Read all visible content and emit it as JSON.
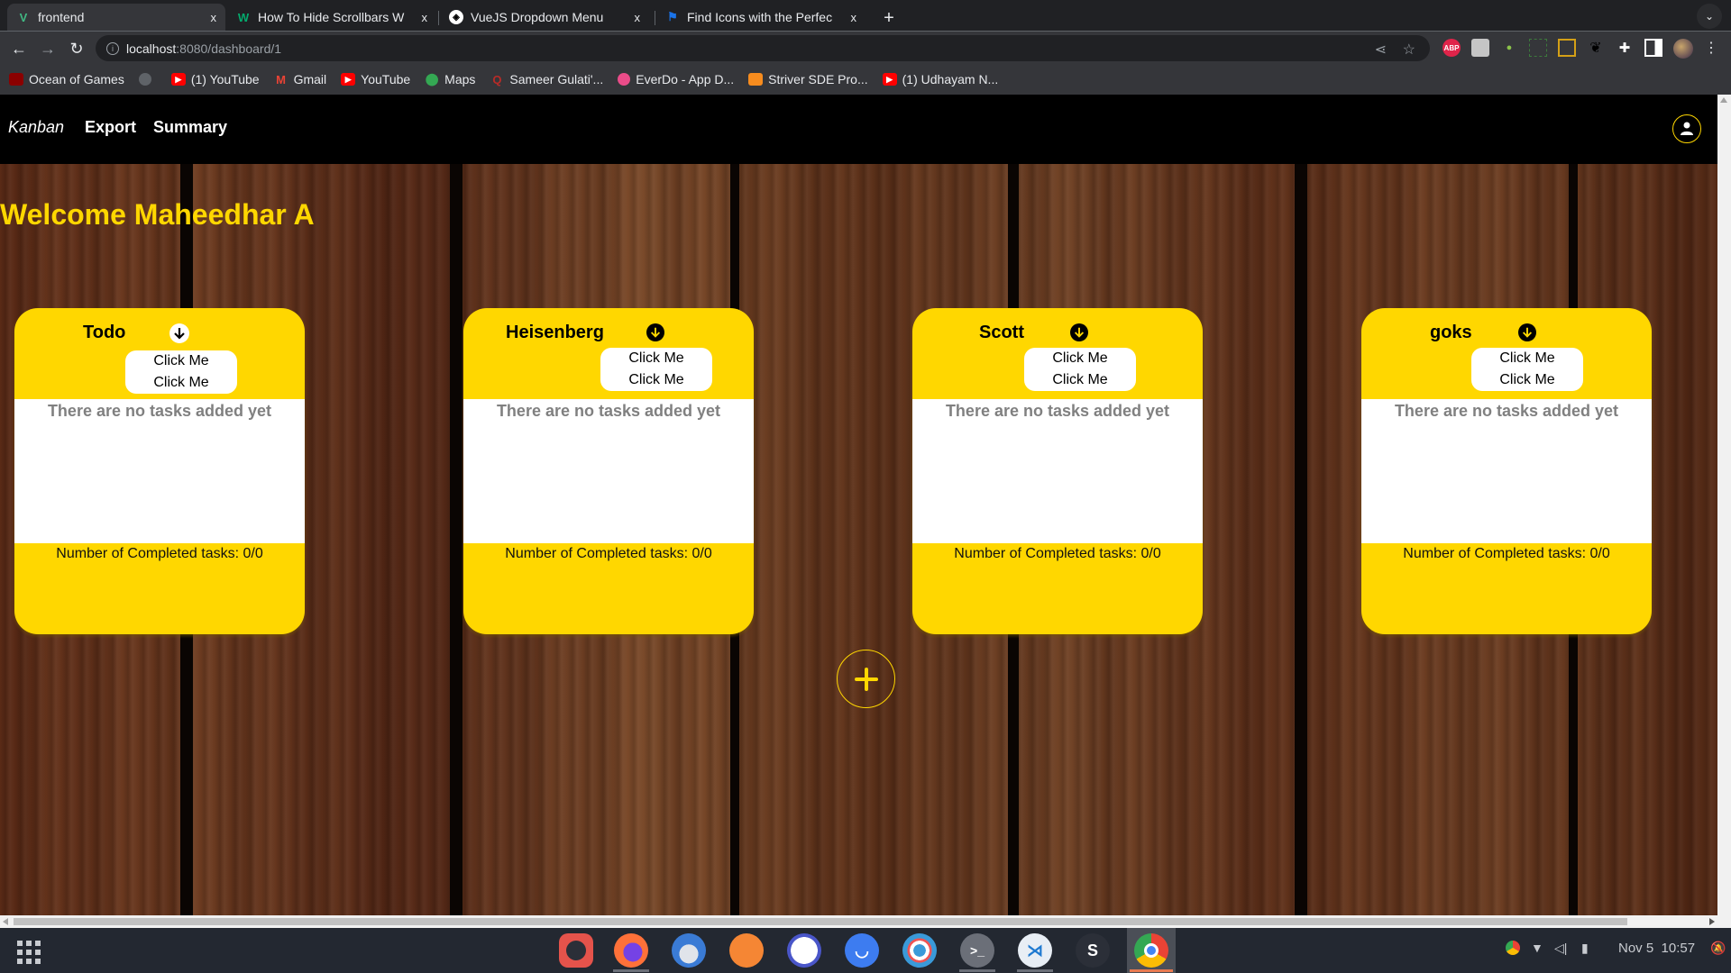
{
  "browser": {
    "tabs": [
      {
        "title": "frontend",
        "favicon": "vue-icon",
        "active": true
      },
      {
        "title": "How To Hide Scrollbars W",
        "favicon": "w3schools-icon",
        "active": false
      },
      {
        "title": "VueJS Dropdown Menu",
        "favicon": "codepen-icon",
        "active": false
      },
      {
        "title": "Find Icons with the Perfec",
        "favicon": "flag-icon",
        "active": false
      }
    ],
    "close_glyph": "x",
    "new_tab_glyph": "+",
    "url_host": "localhost",
    "url_path": ":8080/dashboard/1",
    "bookmarks": [
      {
        "label": "Ocean of Games",
        "icon": "gamepad-icon",
        "color": "#8b0000"
      },
      {
        "label": "",
        "icon": "globe-icon",
        "color": "#5f6368"
      },
      {
        "label": "(1) YouTube",
        "icon": "youtube-icon",
        "color": "#ff0000"
      },
      {
        "label": "Gmail",
        "icon": "gmail-icon",
        "color": "#ea4335"
      },
      {
        "label": "YouTube",
        "icon": "youtube-icon",
        "color": "#ff0000"
      },
      {
        "label": "Maps",
        "icon": "maps-icon",
        "color": "#34a853"
      },
      {
        "label": "Sameer Gulati'...",
        "icon": "quora-icon",
        "color": "#b92b27"
      },
      {
        "label": "EverDo - App D...",
        "icon": "dribbble-icon",
        "color": "#ea4c89"
      },
      {
        "label": "Striver SDE Pro...",
        "icon": "codingninjas-icon",
        "color": "#f78c1e"
      },
      {
        "label": "(1) Udhayam N...",
        "icon": "youtube-icon",
        "color": "#ff0000"
      }
    ],
    "extensions": [
      "abp-icon",
      "contact-icon",
      "download-x-icon",
      "screen-capture-icon",
      "window-resizer-icon",
      "gnome-icon",
      "puzzle-extensions-icon",
      "side-panel-icon",
      "profile-avatar-icon",
      "kebab-menu-icon"
    ],
    "abp_label": "ABP"
  },
  "app": {
    "nav": {
      "brand": "Kanban",
      "export": "Export",
      "summary": "Summary"
    },
    "welcome": "Welcome Maheedhar A",
    "colors": {
      "accent": "#ffd700",
      "header_bg": "#000000",
      "empty_text": "#808080"
    },
    "boards": [
      {
        "title": "Todo",
        "menu_items": [
          "Click Me",
          "Click Me"
        ],
        "empty_text": "There are no tasks added yet",
        "completed_label": "Number of Completed tasks:",
        "completed": 0,
        "total": 0,
        "completed_text": "Number of Completed tasks: 0/0",
        "icon_style": "light"
      },
      {
        "title": "Heisenberg",
        "menu_items": [
          "Click Me",
          "Click Me"
        ],
        "empty_text": "There are no tasks added yet",
        "completed_label": "Number of Completed tasks:",
        "completed": 0,
        "total": 0,
        "completed_text": "Number of Completed tasks: 0/0",
        "icon_style": "dark"
      },
      {
        "title": "Scott",
        "menu_items": [
          "Click Me",
          "Click Me"
        ],
        "empty_text": "There are no tasks added yet",
        "completed_label": "Number of Completed tasks:",
        "completed": 0,
        "total": 0,
        "completed_text": "Number of Completed tasks: 0/0",
        "icon_style": "dark"
      },
      {
        "title": "goks",
        "menu_items": [
          "Click Me",
          "Click Me"
        ],
        "empty_text": "There are no tasks added yet",
        "completed_label": "Number of Completed tasks:",
        "completed": 0,
        "total": 0,
        "completed_text": "Number of Completed tasks: 0/0",
        "icon_style": "dark"
      }
    ],
    "add_board_glyph": "+"
  },
  "taskbar": {
    "apps": [
      {
        "name": "screen-recorder-icon",
        "color": "#e5534b",
        "glyph": ""
      },
      {
        "name": "firefox-icon",
        "color": "#ff7139",
        "glyph": ""
      },
      {
        "name": "thunderbird-icon",
        "color": "#3a7bd5",
        "glyph": ""
      },
      {
        "name": "files-icon",
        "color": "#f58634",
        "glyph": ""
      },
      {
        "name": "text-editor-icon",
        "color": "#4a56c9",
        "glyph": ""
      },
      {
        "name": "software-store-icon",
        "color": "#3d7cf0",
        "glyph": ""
      },
      {
        "name": "help-icon",
        "color": "#3a9ad9",
        "glyph": ""
      },
      {
        "name": "terminal-icon",
        "color": "#6b6f78",
        "glyph": ">_"
      },
      {
        "name": "vscode-icon",
        "color": "#e8eef5",
        "glyph": ""
      },
      {
        "name": "slack-s-icon",
        "color": "#2b2f38",
        "glyph": "S"
      },
      {
        "name": "chrome-icon",
        "color": "#4285f4",
        "glyph": ""
      }
    ],
    "date": "Nov 5",
    "time": "10:57"
  }
}
